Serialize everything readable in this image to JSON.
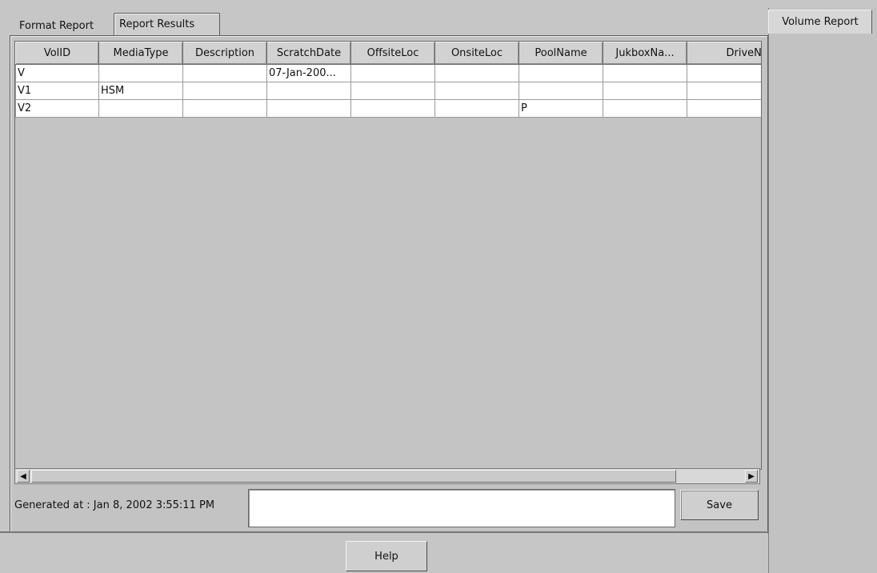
{
  "tabs": {
    "format_report": "Format Report",
    "report_results": "Report Results",
    "volume_report": "Volume Report"
  },
  "table": {
    "headers": [
      "VolID",
      "MediaType",
      "Description",
      "ScratchDate",
      "OffsiteLoc",
      "OnsiteLoc",
      "PoolName",
      "JukboxNa...",
      "DriveName"
    ],
    "rows": [
      [
        "V",
        "",
        "",
        "07-Jan-200...",
        "",
        "",
        "",
        "",
        ""
      ],
      [
        "V1",
        "HSM",
        "",
        "",
        "",
        "",
        "",
        "",
        ""
      ],
      [
        "V2",
        "",
        "",
        "",
        "",
        "",
        "P",
        "",
        ""
      ]
    ]
  },
  "footer": {
    "generated_label": "Generated at : Jan 8, 2002 3:55:11 PM",
    "save_label": "Save",
    "help_label": "Help"
  },
  "colors": {
    "background": "#c6c6c6",
    "cell_background": "#ffffff"
  }
}
